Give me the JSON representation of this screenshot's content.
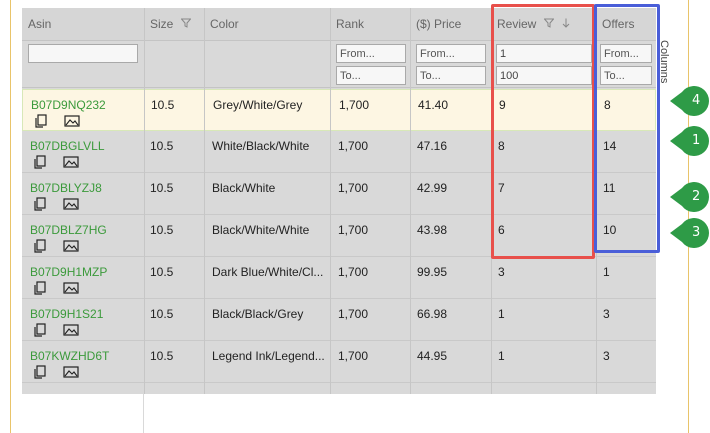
{
  "columns": [
    {
      "key": "asin",
      "label": "Asin",
      "filter_icon": false,
      "sort_icon": false
    },
    {
      "key": "size",
      "label": "Size",
      "filter_icon": true,
      "sort_icon": false
    },
    {
      "key": "color",
      "label": "Color",
      "filter_icon": false,
      "sort_icon": false
    },
    {
      "key": "rank",
      "label": "Rank",
      "filter_icon": false,
      "sort_icon": false
    },
    {
      "key": "price",
      "label": "($) Price",
      "filter_icon": false,
      "sort_icon": false
    },
    {
      "key": "review",
      "label": "Review",
      "filter_icon": true,
      "sort_icon": true
    },
    {
      "key": "offers",
      "label": "Offers",
      "filter_icon": false,
      "sort_icon": false
    }
  ],
  "filters": {
    "asin": {
      "value": "",
      "placeholder": ""
    },
    "rank_from": {
      "value": "",
      "placeholder": "From..."
    },
    "rank_to": {
      "value": "",
      "placeholder": "To..."
    },
    "price_from": {
      "value": "",
      "placeholder": "From..."
    },
    "price_to": {
      "value": "",
      "placeholder": "To..."
    },
    "review_from": {
      "value": "1",
      "placeholder": ""
    },
    "review_to": {
      "value": "100",
      "placeholder": ""
    },
    "offers_from": {
      "value": "",
      "placeholder": "From..."
    },
    "offers_to": {
      "value": "",
      "placeholder": "To..."
    }
  },
  "rows": [
    {
      "asin": "B07D9NQ232",
      "size": "10.5",
      "color": "Grey/White/Grey",
      "rank": "1,700",
      "price": "41.40",
      "review": "9",
      "offers": "8"
    },
    {
      "asin": "B07DBGLVLL",
      "size": "10.5",
      "color": "White/Black/White",
      "rank": "1,700",
      "price": "47.16",
      "review": "8",
      "offers": "14"
    },
    {
      "asin": "B07DBLYZJ8",
      "size": "10.5",
      "color": "Black/White",
      "rank": "1,700",
      "price": "42.99",
      "review": "7",
      "offers": "11"
    },
    {
      "asin": "B07DBLZ7HG",
      "size": "10.5",
      "color": "Black/White/White",
      "rank": "1,700",
      "price": "43.98",
      "review": "6",
      "offers": "10"
    },
    {
      "asin": "B07D9H1MZP",
      "size": "10.5",
      "color": "Dark Blue/White/Cl...",
      "rank": "1,700",
      "price": "99.95",
      "review": "3",
      "offers": "1"
    },
    {
      "asin": "B07D9H1S21",
      "size": "10.5",
      "color": "Black/Black/Grey",
      "rank": "1,700",
      "price": "66.98",
      "review": "1",
      "offers": "3"
    },
    {
      "asin": "B07KWZHD6T",
      "size": "10.5",
      "color": "Legend Ink/Legend...",
      "rank": "1,700",
      "price": "44.95",
      "review": "1",
      "offers": "3"
    }
  ],
  "row_icons": [
    "copy-icon",
    "image-icon"
  ],
  "columns_panel": {
    "label": "Columns"
  },
  "annotations": {
    "badges": [
      "4",
      "1",
      "2",
      "3"
    ],
    "badge_color": "#2e9b47",
    "review_box_color": "#e8504b",
    "offers_box_color": "#4a5ed8"
  }
}
